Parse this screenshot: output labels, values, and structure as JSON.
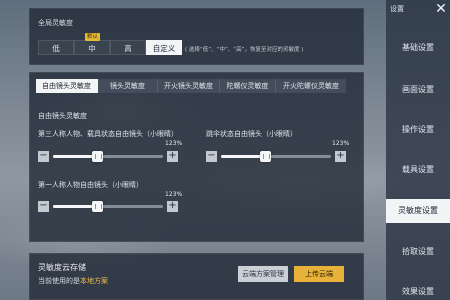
{
  "global_sensitivity": {
    "title": "全局灵敏度",
    "options": [
      "低",
      "中",
      "高",
      "自定义"
    ],
    "active_index": 3,
    "badge": "默认",
    "hint": "( 选择“低”、“中”、“高”，恢复至对应的灵敏度 )"
  },
  "tabs": [
    "自由镜头灵敏度",
    "镜头灵敏度",
    "开火镜头灵敏度",
    "陀螺仪灵敏度",
    "开火陀螺仪灵敏度"
  ],
  "active_tab_index": 0,
  "section_title": "自由镜头灵敏度",
  "sliders": [
    {
      "label": "第三人称人物、载具状态自由镜头（小眼睛）",
      "value_text": "123%",
      "fraction": 0.4
    },
    {
      "label": "跳伞状态自由镜头（小眼睛）",
      "value_text": "123%",
      "fraction": 0.4
    },
    {
      "label": "第一人称人物自由镜头（小眼睛）",
      "value_text": "123%",
      "fraction": 0.4
    }
  ],
  "cloud": {
    "title": "灵敏度云存储",
    "current_prefix": "当前使用的是",
    "current_value": "本地方案",
    "manage_label": "云端方案管理",
    "upload_label": "上传云端"
  },
  "sidebar": {
    "top_label": "设置",
    "items": [
      "基础设置",
      "画面设置",
      "操作设置",
      "载具设置",
      "灵敏度设置",
      "拾取设置",
      "效果设置"
    ],
    "active_index": 4
  },
  "colors": {
    "accent": "#e8b23a",
    "active_bg": "#f2f4f6"
  }
}
